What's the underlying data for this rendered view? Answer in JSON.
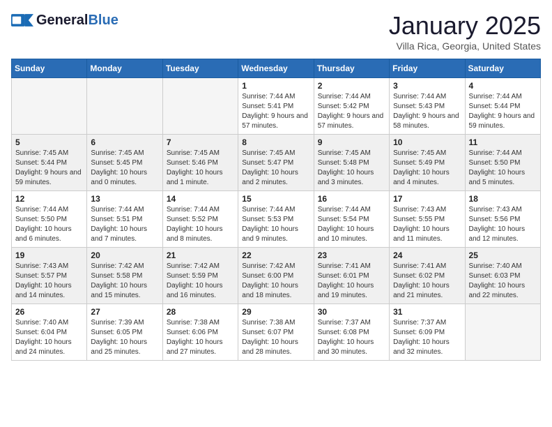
{
  "header": {
    "logo_general": "General",
    "logo_blue": "Blue",
    "month_title": "January 2025",
    "subtitle": "Villa Rica, Georgia, United States"
  },
  "weekdays": [
    "Sunday",
    "Monday",
    "Tuesday",
    "Wednesday",
    "Thursday",
    "Friday",
    "Saturday"
  ],
  "weeks": [
    [
      {
        "day": "",
        "info": ""
      },
      {
        "day": "",
        "info": ""
      },
      {
        "day": "",
        "info": ""
      },
      {
        "day": "1",
        "info": "Sunrise: 7:44 AM\nSunset: 5:41 PM\nDaylight: 9 hours and 57 minutes."
      },
      {
        "day": "2",
        "info": "Sunrise: 7:44 AM\nSunset: 5:42 PM\nDaylight: 9 hours and 57 minutes."
      },
      {
        "day": "3",
        "info": "Sunrise: 7:44 AM\nSunset: 5:43 PM\nDaylight: 9 hours and 58 minutes."
      },
      {
        "day": "4",
        "info": "Sunrise: 7:44 AM\nSunset: 5:44 PM\nDaylight: 9 hours and 59 minutes."
      }
    ],
    [
      {
        "day": "5",
        "info": "Sunrise: 7:45 AM\nSunset: 5:44 PM\nDaylight: 9 hours and 59 minutes."
      },
      {
        "day": "6",
        "info": "Sunrise: 7:45 AM\nSunset: 5:45 PM\nDaylight: 10 hours and 0 minutes."
      },
      {
        "day": "7",
        "info": "Sunrise: 7:45 AM\nSunset: 5:46 PM\nDaylight: 10 hours and 1 minute."
      },
      {
        "day": "8",
        "info": "Sunrise: 7:45 AM\nSunset: 5:47 PM\nDaylight: 10 hours and 2 minutes."
      },
      {
        "day": "9",
        "info": "Sunrise: 7:45 AM\nSunset: 5:48 PM\nDaylight: 10 hours and 3 minutes."
      },
      {
        "day": "10",
        "info": "Sunrise: 7:45 AM\nSunset: 5:49 PM\nDaylight: 10 hours and 4 minutes."
      },
      {
        "day": "11",
        "info": "Sunrise: 7:44 AM\nSunset: 5:50 PM\nDaylight: 10 hours and 5 minutes."
      }
    ],
    [
      {
        "day": "12",
        "info": "Sunrise: 7:44 AM\nSunset: 5:50 PM\nDaylight: 10 hours and 6 minutes."
      },
      {
        "day": "13",
        "info": "Sunrise: 7:44 AM\nSunset: 5:51 PM\nDaylight: 10 hours and 7 minutes."
      },
      {
        "day": "14",
        "info": "Sunrise: 7:44 AM\nSunset: 5:52 PM\nDaylight: 10 hours and 8 minutes."
      },
      {
        "day": "15",
        "info": "Sunrise: 7:44 AM\nSunset: 5:53 PM\nDaylight: 10 hours and 9 minutes."
      },
      {
        "day": "16",
        "info": "Sunrise: 7:44 AM\nSunset: 5:54 PM\nDaylight: 10 hours and 10 minutes."
      },
      {
        "day": "17",
        "info": "Sunrise: 7:43 AM\nSunset: 5:55 PM\nDaylight: 10 hours and 11 minutes."
      },
      {
        "day": "18",
        "info": "Sunrise: 7:43 AM\nSunset: 5:56 PM\nDaylight: 10 hours and 12 minutes."
      }
    ],
    [
      {
        "day": "19",
        "info": "Sunrise: 7:43 AM\nSunset: 5:57 PM\nDaylight: 10 hours and 14 minutes."
      },
      {
        "day": "20",
        "info": "Sunrise: 7:42 AM\nSunset: 5:58 PM\nDaylight: 10 hours and 15 minutes."
      },
      {
        "day": "21",
        "info": "Sunrise: 7:42 AM\nSunset: 5:59 PM\nDaylight: 10 hours and 16 minutes."
      },
      {
        "day": "22",
        "info": "Sunrise: 7:42 AM\nSunset: 6:00 PM\nDaylight: 10 hours and 18 minutes."
      },
      {
        "day": "23",
        "info": "Sunrise: 7:41 AM\nSunset: 6:01 PM\nDaylight: 10 hours and 19 minutes."
      },
      {
        "day": "24",
        "info": "Sunrise: 7:41 AM\nSunset: 6:02 PM\nDaylight: 10 hours and 21 minutes."
      },
      {
        "day": "25",
        "info": "Sunrise: 7:40 AM\nSunset: 6:03 PM\nDaylight: 10 hours and 22 minutes."
      }
    ],
    [
      {
        "day": "26",
        "info": "Sunrise: 7:40 AM\nSunset: 6:04 PM\nDaylight: 10 hours and 24 minutes."
      },
      {
        "day": "27",
        "info": "Sunrise: 7:39 AM\nSunset: 6:05 PM\nDaylight: 10 hours and 25 minutes."
      },
      {
        "day": "28",
        "info": "Sunrise: 7:38 AM\nSunset: 6:06 PM\nDaylight: 10 hours and 27 minutes."
      },
      {
        "day": "29",
        "info": "Sunrise: 7:38 AM\nSunset: 6:07 PM\nDaylight: 10 hours and 28 minutes."
      },
      {
        "day": "30",
        "info": "Sunrise: 7:37 AM\nSunset: 6:08 PM\nDaylight: 10 hours and 30 minutes."
      },
      {
        "day": "31",
        "info": "Sunrise: 7:37 AM\nSunset: 6:09 PM\nDaylight: 10 hours and 32 minutes."
      },
      {
        "day": "",
        "info": ""
      }
    ]
  ]
}
